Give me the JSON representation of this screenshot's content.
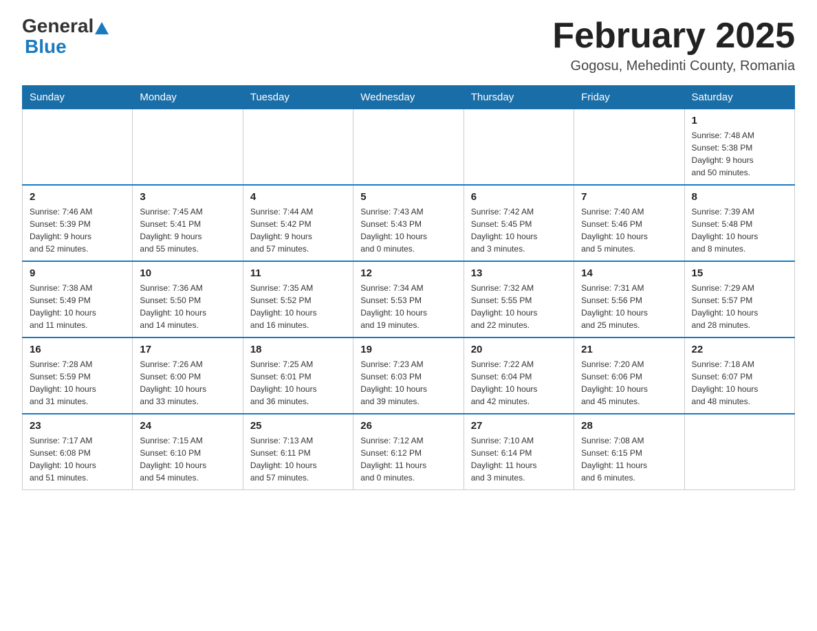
{
  "header": {
    "logo_general": "General",
    "logo_blue": "Blue",
    "title": "February 2025",
    "location": "Gogosu, Mehedinti County, Romania"
  },
  "days_of_week": [
    "Sunday",
    "Monday",
    "Tuesday",
    "Wednesday",
    "Thursday",
    "Friday",
    "Saturday"
  ],
  "weeks": [
    {
      "days": [
        {
          "number": "",
          "info": ""
        },
        {
          "number": "",
          "info": ""
        },
        {
          "number": "",
          "info": ""
        },
        {
          "number": "",
          "info": ""
        },
        {
          "number": "",
          "info": ""
        },
        {
          "number": "",
          "info": ""
        },
        {
          "number": "1",
          "info": "Sunrise: 7:48 AM\nSunset: 5:38 PM\nDaylight: 9 hours\nand 50 minutes."
        }
      ]
    },
    {
      "days": [
        {
          "number": "2",
          "info": "Sunrise: 7:46 AM\nSunset: 5:39 PM\nDaylight: 9 hours\nand 52 minutes."
        },
        {
          "number": "3",
          "info": "Sunrise: 7:45 AM\nSunset: 5:41 PM\nDaylight: 9 hours\nand 55 minutes."
        },
        {
          "number": "4",
          "info": "Sunrise: 7:44 AM\nSunset: 5:42 PM\nDaylight: 9 hours\nand 57 minutes."
        },
        {
          "number": "5",
          "info": "Sunrise: 7:43 AM\nSunset: 5:43 PM\nDaylight: 10 hours\nand 0 minutes."
        },
        {
          "number": "6",
          "info": "Sunrise: 7:42 AM\nSunset: 5:45 PM\nDaylight: 10 hours\nand 3 minutes."
        },
        {
          "number": "7",
          "info": "Sunrise: 7:40 AM\nSunset: 5:46 PM\nDaylight: 10 hours\nand 5 minutes."
        },
        {
          "number": "8",
          "info": "Sunrise: 7:39 AM\nSunset: 5:48 PM\nDaylight: 10 hours\nand 8 minutes."
        }
      ]
    },
    {
      "days": [
        {
          "number": "9",
          "info": "Sunrise: 7:38 AM\nSunset: 5:49 PM\nDaylight: 10 hours\nand 11 minutes."
        },
        {
          "number": "10",
          "info": "Sunrise: 7:36 AM\nSunset: 5:50 PM\nDaylight: 10 hours\nand 14 minutes."
        },
        {
          "number": "11",
          "info": "Sunrise: 7:35 AM\nSunset: 5:52 PM\nDaylight: 10 hours\nand 16 minutes."
        },
        {
          "number": "12",
          "info": "Sunrise: 7:34 AM\nSunset: 5:53 PM\nDaylight: 10 hours\nand 19 minutes."
        },
        {
          "number": "13",
          "info": "Sunrise: 7:32 AM\nSunset: 5:55 PM\nDaylight: 10 hours\nand 22 minutes."
        },
        {
          "number": "14",
          "info": "Sunrise: 7:31 AM\nSunset: 5:56 PM\nDaylight: 10 hours\nand 25 minutes."
        },
        {
          "number": "15",
          "info": "Sunrise: 7:29 AM\nSunset: 5:57 PM\nDaylight: 10 hours\nand 28 minutes."
        }
      ]
    },
    {
      "days": [
        {
          "number": "16",
          "info": "Sunrise: 7:28 AM\nSunset: 5:59 PM\nDaylight: 10 hours\nand 31 minutes."
        },
        {
          "number": "17",
          "info": "Sunrise: 7:26 AM\nSunset: 6:00 PM\nDaylight: 10 hours\nand 33 minutes."
        },
        {
          "number": "18",
          "info": "Sunrise: 7:25 AM\nSunset: 6:01 PM\nDaylight: 10 hours\nand 36 minutes."
        },
        {
          "number": "19",
          "info": "Sunrise: 7:23 AM\nSunset: 6:03 PM\nDaylight: 10 hours\nand 39 minutes."
        },
        {
          "number": "20",
          "info": "Sunrise: 7:22 AM\nSunset: 6:04 PM\nDaylight: 10 hours\nand 42 minutes."
        },
        {
          "number": "21",
          "info": "Sunrise: 7:20 AM\nSunset: 6:06 PM\nDaylight: 10 hours\nand 45 minutes."
        },
        {
          "number": "22",
          "info": "Sunrise: 7:18 AM\nSunset: 6:07 PM\nDaylight: 10 hours\nand 48 minutes."
        }
      ]
    },
    {
      "days": [
        {
          "number": "23",
          "info": "Sunrise: 7:17 AM\nSunset: 6:08 PM\nDaylight: 10 hours\nand 51 minutes."
        },
        {
          "number": "24",
          "info": "Sunrise: 7:15 AM\nSunset: 6:10 PM\nDaylight: 10 hours\nand 54 minutes."
        },
        {
          "number": "25",
          "info": "Sunrise: 7:13 AM\nSunset: 6:11 PM\nDaylight: 10 hours\nand 57 minutes."
        },
        {
          "number": "26",
          "info": "Sunrise: 7:12 AM\nSunset: 6:12 PM\nDaylight: 11 hours\nand 0 minutes."
        },
        {
          "number": "27",
          "info": "Sunrise: 7:10 AM\nSunset: 6:14 PM\nDaylight: 11 hours\nand 3 minutes."
        },
        {
          "number": "28",
          "info": "Sunrise: 7:08 AM\nSunset: 6:15 PM\nDaylight: 11 hours\nand 6 minutes."
        },
        {
          "number": "",
          "info": ""
        }
      ]
    }
  ]
}
